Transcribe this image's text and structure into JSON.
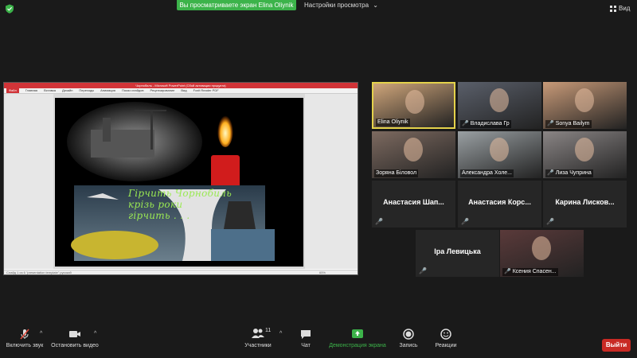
{
  "top": {
    "share_banner": "Вы просматриваете экран Elina Oliynik",
    "view_options": "Настройки просмотра",
    "view_button": "Вид"
  },
  "shared_screen": {
    "window_title": "Чорнобиль - Microsoft PowerPoint (Сбой активации продукта)",
    "ribbon_tabs": [
      "Файл",
      "Главная",
      "Вставка",
      "Дизайн",
      "Переходы",
      "Анимация",
      "Показ слайдов",
      "Рецензирование",
      "Вид",
      "Foxit Reader PDF"
    ],
    "status_text": "Слайд 1 из 6   \"presentation template\"   русский",
    "zoom": "65%",
    "slide_lines": [
      "Гірчить Чорнобиль",
      "крізь роки",
      "гірчить . . ."
    ]
  },
  "participants": [
    {
      "name": "Elina Oliynik",
      "muted": false,
      "video": true,
      "active": true,
      "bg": "#cfa57a"
    },
    {
      "name": "Владислава Гр",
      "muted": true,
      "video": true,
      "active": false,
      "bg": "#5a5f6a"
    },
    {
      "name": "Sonya Bailym",
      "muted": true,
      "video": true,
      "active": false,
      "bg": "#c89a78"
    },
    {
      "name": "Зоряна Біловол",
      "muted": false,
      "video": true,
      "active": false,
      "bg": "#7d6a60"
    },
    {
      "name": "Александра Холе...",
      "muted": false,
      "video": true,
      "active": false,
      "bg": "#9aa0a3"
    },
    {
      "name": "Лиза Чуприна",
      "muted": true,
      "video": true,
      "active": false,
      "bg": "#8a8585"
    },
    {
      "name": "Анастасия Шап...",
      "muted": true,
      "video": false,
      "active": false
    },
    {
      "name": "Анастасия Корс...",
      "muted": true,
      "video": false,
      "active": false
    },
    {
      "name": "Карина Лисков...",
      "muted": true,
      "video": false,
      "active": false
    },
    {
      "name": "Іра Левицька",
      "muted": true,
      "video": false,
      "active": false
    },
    {
      "name": "Ксения Спасен...",
      "muted": true,
      "video": true,
      "active": false,
      "bg": "#5a3a3a"
    }
  ],
  "toolbar": {
    "unmute_label": "Включить звук",
    "stop_video_label": "Остановить видео",
    "participants_label": "Участники",
    "participants_count": "11",
    "chat_label": "Чат",
    "share_label": "Демонстрация экрана",
    "record_label": "Запись",
    "reactions_label": "Реакции",
    "leave_label": "Выйти"
  },
  "colors": {
    "accent_green": "#3cb34a",
    "active_speaker": "#e4d24b",
    "muted_red": "#e24a3b",
    "leave_red": "#c82a24"
  }
}
